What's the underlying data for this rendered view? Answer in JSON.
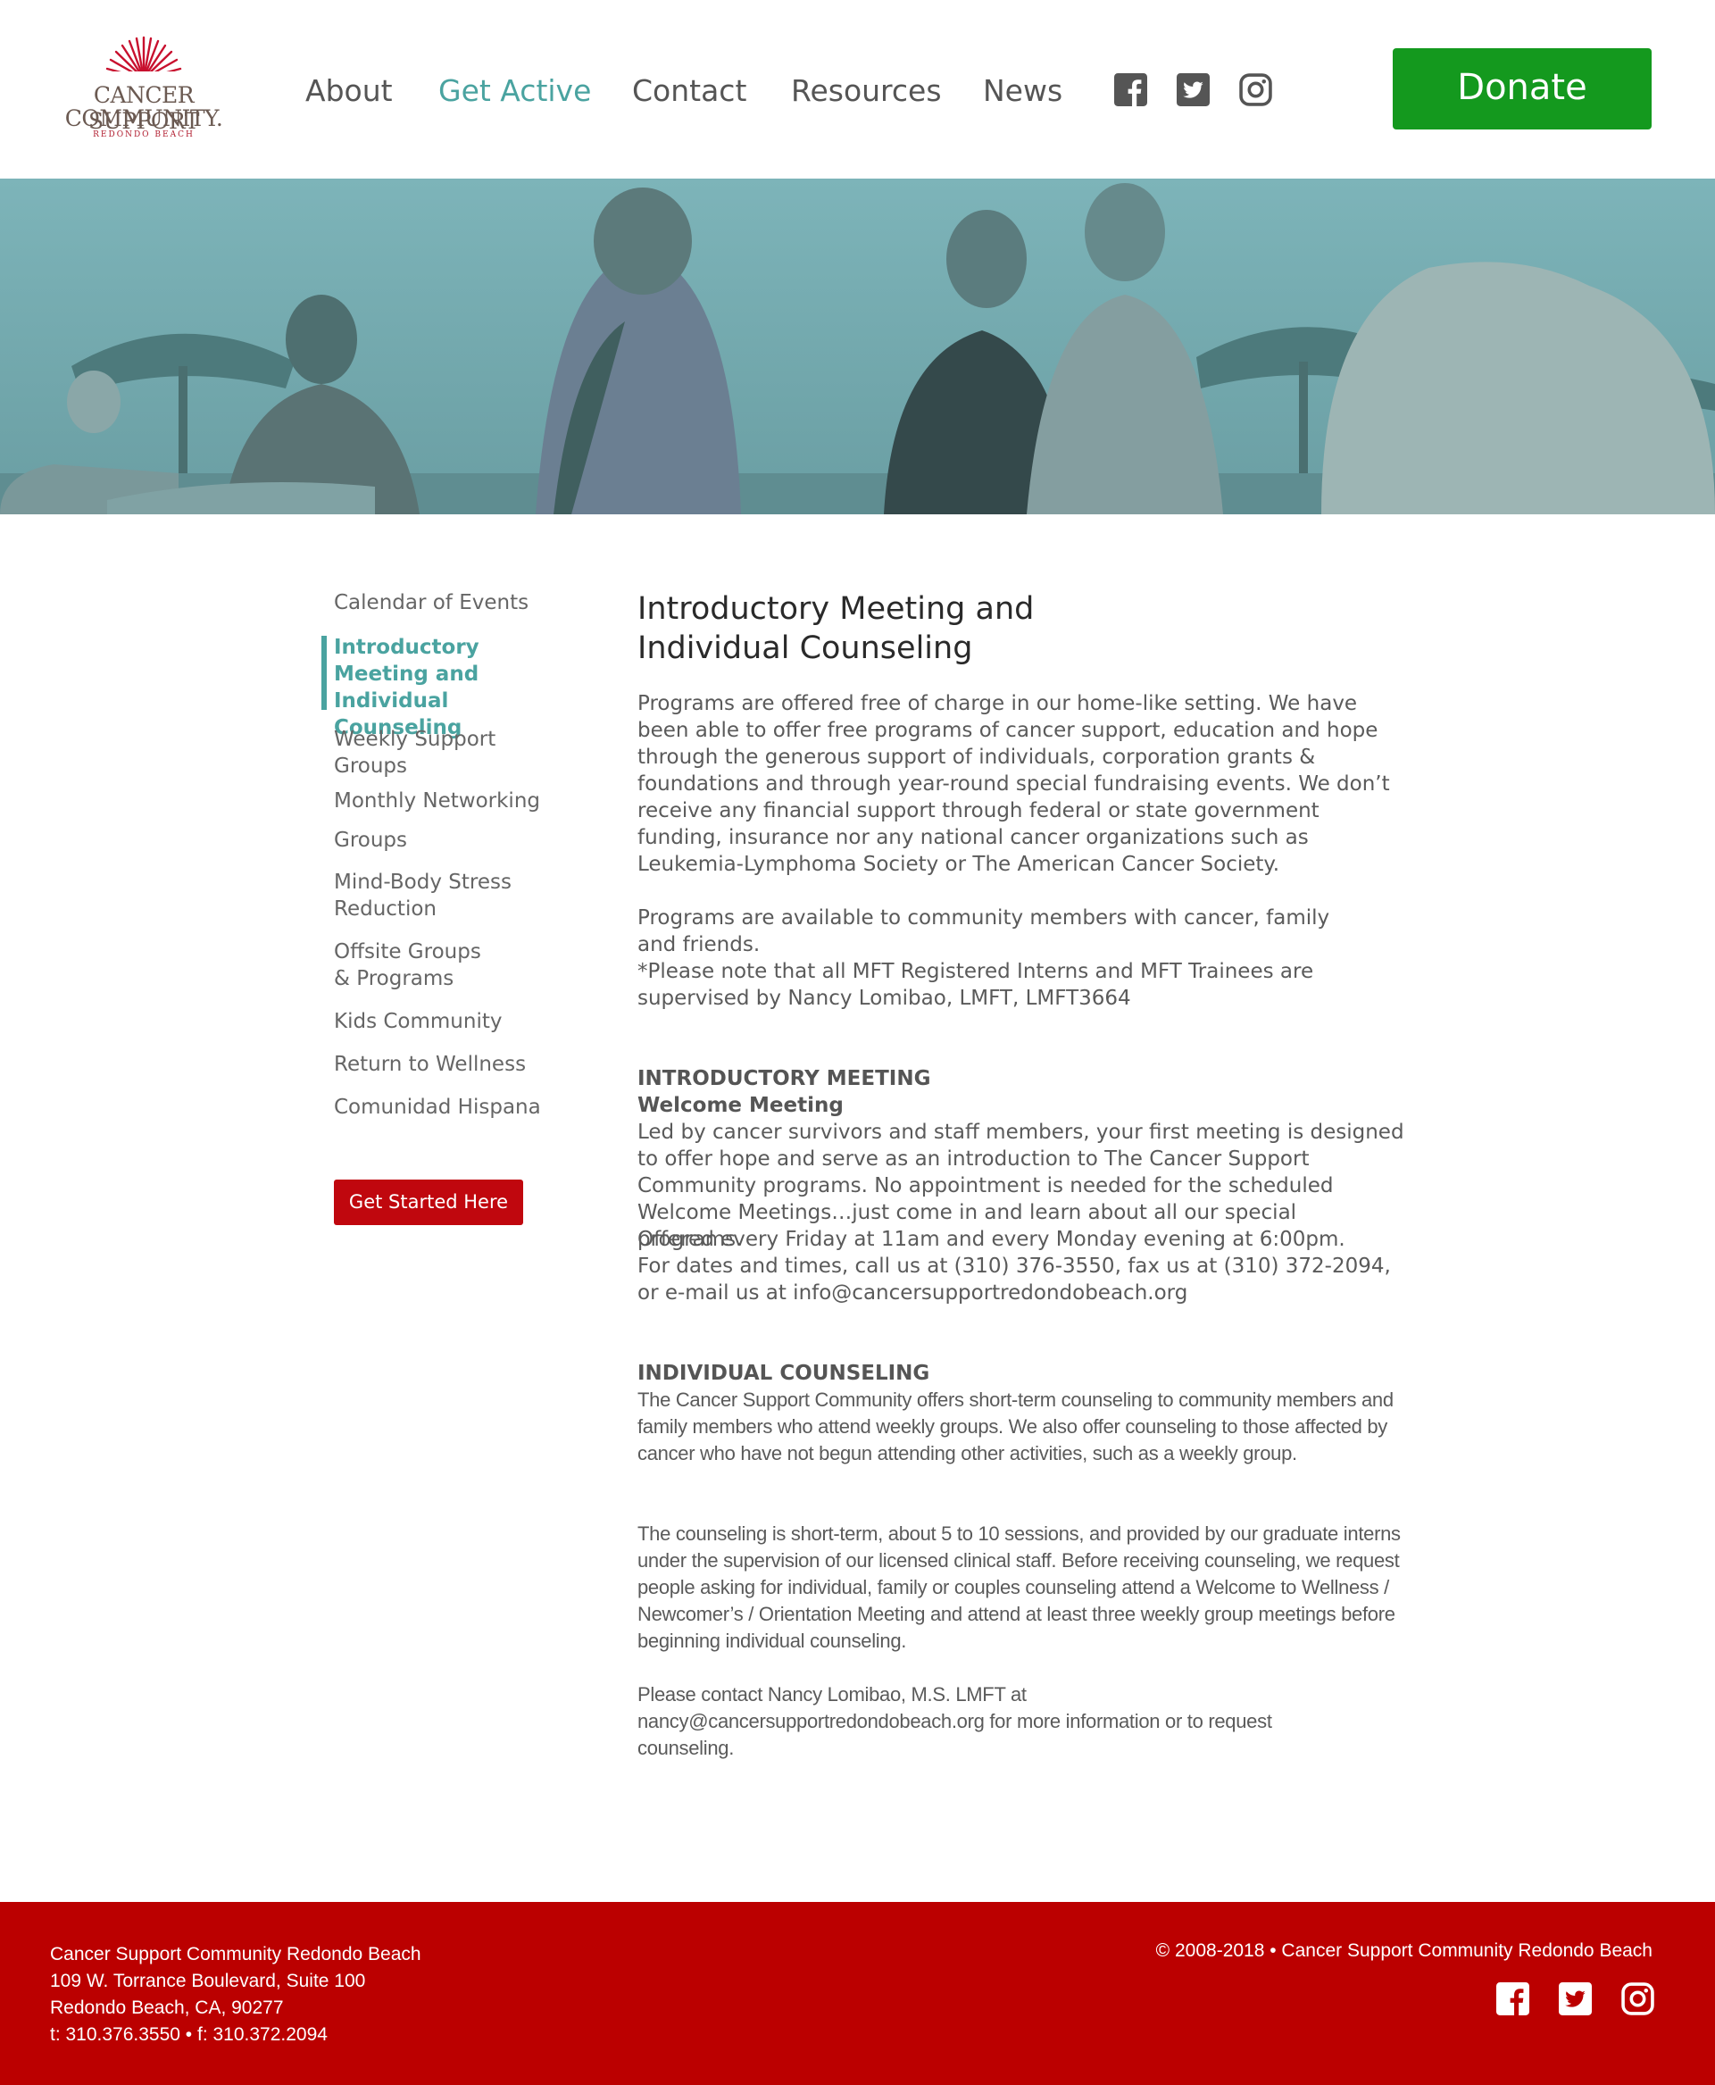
{
  "brand": {
    "logo_line1": "CANCER SUPPORT",
    "logo_line2": "COMMUNITY.",
    "logo_line3": "REDONDO BEACH",
    "accent_color": "#4aa3a0",
    "donate_color": "#14991e",
    "footer_color": "#bb0000",
    "cta_color": "#c0070e"
  },
  "nav": {
    "items": [
      {
        "label": "About",
        "active": false
      },
      {
        "label": "Get Active",
        "active": true
      },
      {
        "label": "Contact",
        "active": false
      },
      {
        "label": "Resources",
        "active": false
      },
      {
        "label": "News",
        "active": false
      }
    ],
    "social": [
      "facebook-icon",
      "twitter-icon",
      "instagram-icon"
    ],
    "donate_label": "Donate"
  },
  "hero": {
    "alt": "people meditating on the beach"
  },
  "sidebar": {
    "items": [
      {
        "label": "Calendar of Events"
      },
      {
        "label": "Introductory Meeting and Individual Counseling",
        "active": true
      },
      {
        "label": "Weekly Support Groups"
      },
      {
        "label": "Monthly Networking"
      },
      {
        "label": "Groups"
      },
      {
        "label": "Mind-Body Stress Reduction"
      },
      {
        "label": "Offsite Groups & Programs"
      },
      {
        "label": "Kids Community"
      },
      {
        "label": "Return to Wellness"
      },
      {
        "label": "Comunidad Hispana"
      }
    ],
    "cta_label": "Get Started Here"
  },
  "main": {
    "title_line1": "Introductory Meeting and",
    "title_line2": "Individual Counseling",
    "p1": "Programs are offered free of charge in our home-like setting. We have been able to offer free programs of cancer support, education and hope through the generous support of individuals, corporation grants & foundations and through year-round special fundraising events. We don’t receive any financial support through federal or state government funding, insurance nor any national cancer organizations such as Leukemia-Lymphoma Society or The American Cancer Society.",
    "p2": "Programs are available to community members with cancer, family and friends.",
    "p3": "*Please note that all MFT Registered Interns and MFT Trainees are supervised by Nancy Lomibao, LMFT, LMFT3664",
    "intro_heading": "INTRODUCTORY MEETING",
    "intro_subheading": "Welcome Meeting",
    "intro_text": "Led by cancer survivors and staff members, your first meeting is designed to offer hope and serve as an introduction to The Cancer Support Community programs. No appointment is needed for the scheduled Welcome Meetings…just come in and learn about all our special programs.",
    "offered_line1": "Offered every Friday at 11am and every Monday evening at 6:00pm.",
    "offered_line2": "For dates and times, call us at (310) 376-3550, fax us at (310) 372-2094, or e-mail us at info@cancersupportredondobeach.org",
    "indiv_heading": "INDIVIDUAL COUNSELING",
    "indiv_p1": "The Cancer Support Community offers short-term counseling to community members and family members who attend weekly groups. We also offer counseling to those affected by cancer who have not begun attending other activities, such as a weekly group.",
    "indiv_p2": "The counseling is short-term, about 5 to 10 sessions, and provided by our graduate interns under the supervision of our licensed clinical staff. Before receiving counseling, we request people asking for individual, family or couples counseling attend a Welcome to Wellness / Newcomer’s / Orientation Meeting and attend at least three weekly group meetings before beginning individual counseling.",
    "indiv_p3": "Please contact Nancy Lomibao, M.S. LMFT at nancy@cancersupportredondobeach.org for more information or to request counseling."
  },
  "footer": {
    "addr_line1": "Cancer Support Community Redondo Beach",
    "addr_line2": "109 W. Torrance Boulevard, Suite 100",
    "addr_line3": "Redondo Beach, CA, 90277",
    "addr_line4": "t: 310.376.3550 • f: 310.372.2094",
    "copyright": "© 2008-2018 • Cancer Support Community Redondo Beach",
    "social": [
      "facebook-icon",
      "twitter-icon",
      "instagram-icon"
    ]
  }
}
